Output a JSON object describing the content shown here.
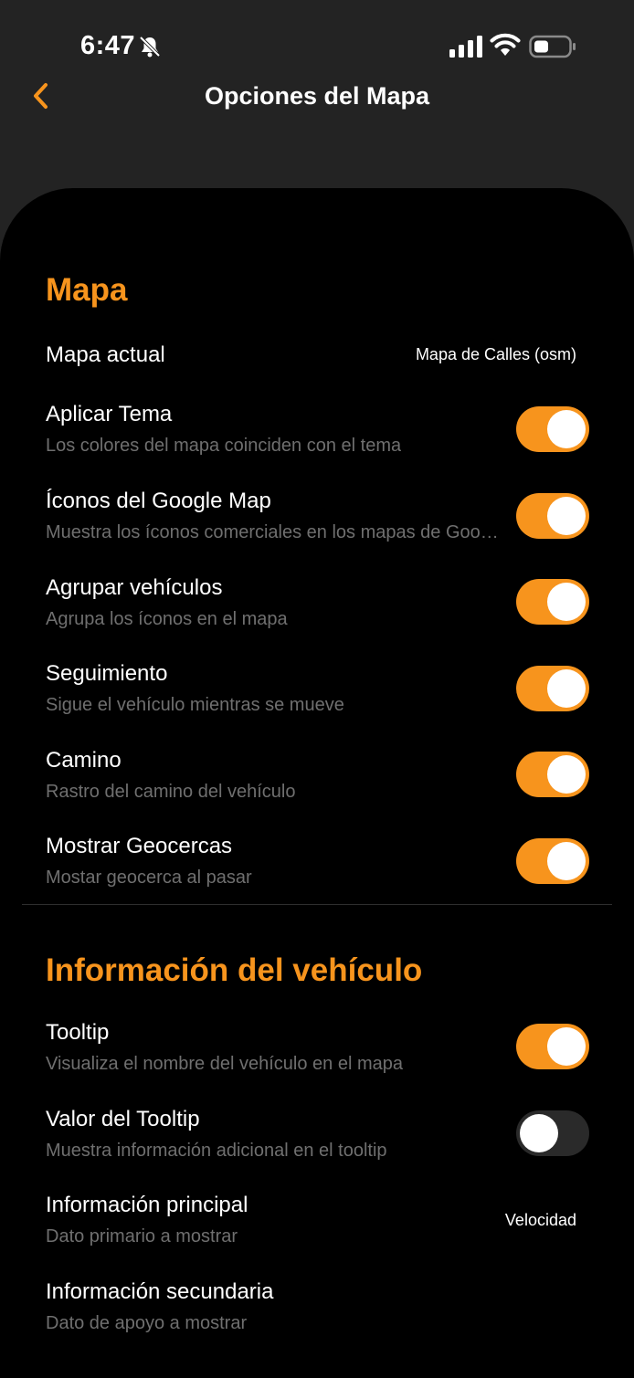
{
  "status_bar": {
    "time": "6:47"
  },
  "nav": {
    "title": "Opciones del Mapa"
  },
  "colors": {
    "accent": "#f7941d",
    "background": "#000000",
    "header": "#232323",
    "subtitle": "#6f6f6f"
  },
  "map_section": {
    "title": "Mapa",
    "current_map": {
      "label": "Mapa actual",
      "value": "Mapa de Calles (osm)"
    },
    "toggles": [
      {
        "title": "Aplicar Tema",
        "subtitle": "Los colores del mapa coinciden con el tema",
        "on": true
      },
      {
        "title": "Íconos del Google Map",
        "subtitle": "Muestra los íconos comerciales en los mapas de Google",
        "on": true
      },
      {
        "title": "Agrupar vehículos",
        "subtitle": "Agrupa los íconos en el mapa",
        "on": true
      },
      {
        "title": "Seguimiento",
        "subtitle": "Sigue el vehículo mientras se mueve",
        "on": true
      },
      {
        "title": "Camino",
        "subtitle": "Rastro del camino del vehículo",
        "on": true
      },
      {
        "title": "Mostrar Geocercas",
        "subtitle": "Mostar geocerca al pasar",
        "on": true
      }
    ]
  },
  "vehicle_section": {
    "title": "Información del vehículo",
    "toggles": [
      {
        "title": "Tooltip",
        "subtitle": "Visualiza el nombre del vehículo en el mapa",
        "on": true
      },
      {
        "title": "Valor del Tooltip",
        "subtitle": "Muestra información adicional en el tooltip",
        "on": false
      }
    ],
    "primary_info": {
      "title": "Información principal",
      "subtitle": "Dato primario a mostrar",
      "value": "Velocidad"
    },
    "secondary_info": {
      "title": "Información secundaria",
      "subtitle": "Dato de apoyo a mostrar"
    }
  }
}
